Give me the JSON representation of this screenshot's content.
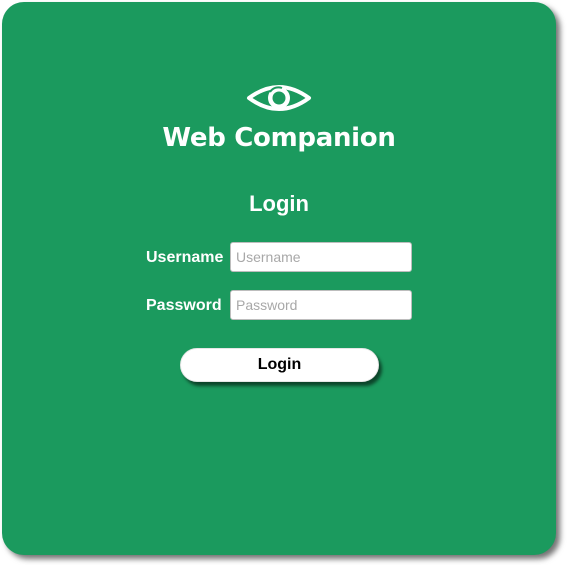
{
  "app": {
    "brand_name": "Web Companion",
    "logo_icon": "eye-icon"
  },
  "login": {
    "title": "Login",
    "username_label": "Username",
    "username_placeholder": "Username",
    "username_value": "",
    "password_label": "Password",
    "password_placeholder": "Password",
    "password_value": "",
    "submit_label": "Login"
  },
  "colors": {
    "card_background": "#1b9a5e",
    "text": "#ffffff",
    "button_background": "#ffffff",
    "button_text": "#000000"
  }
}
